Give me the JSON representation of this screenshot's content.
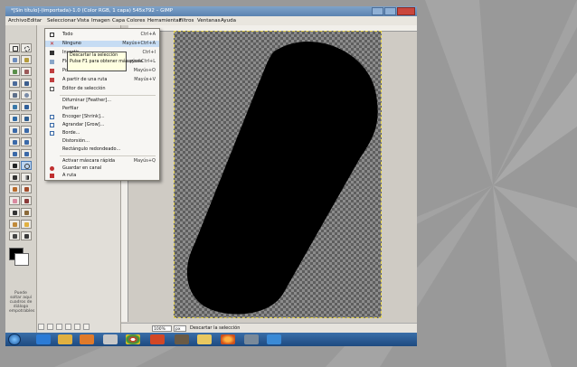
{
  "window": {
    "title": "*[Sin título]-(importada)-1.0 (Color RGB, 1 capa) 545x792 – GIMP"
  },
  "menubar": [
    "Archivo",
    "Editar",
    "Seleccionar",
    "Vista",
    "Imagen",
    "Capa",
    "Colores",
    "Herramientas",
    "Filtros",
    "Ventanas",
    "Ayuda"
  ],
  "select_menu": {
    "items": [
      {
        "label": "Todo",
        "shortcut": "Ctrl+A"
      },
      {
        "label": "Ninguno",
        "shortcut": "Mayús+Ctrl+A"
      },
      {
        "label": "Invertir",
        "shortcut": "Ctrl+I"
      },
      {
        "label": "Flotante",
        "shortcut": "Mayús+Ctrl+L"
      },
      {
        "label": "Por color",
        "shortcut": "Mayús+O"
      },
      {
        "label": "A partir de una ruta",
        "shortcut": "Mayús+V"
      },
      {
        "label": "Editor de selección",
        "shortcut": ""
      },
      {
        "label": "Difuminar [Feather]...",
        "shortcut": ""
      },
      {
        "label": "Perfilar",
        "shortcut": ""
      },
      {
        "label": "Encoger [Shrink]...",
        "shortcut": ""
      },
      {
        "label": "Agrandar [Grow]...",
        "shortcut": ""
      },
      {
        "label": "Borde...",
        "shortcut": ""
      },
      {
        "label": "Distorsión...",
        "shortcut": ""
      },
      {
        "label": "Rectángulo redondeado...",
        "shortcut": ""
      },
      {
        "label": "Activar máscara rápida",
        "shortcut": "Mayús+Q"
      },
      {
        "label": "Guardar en canal",
        "shortcut": ""
      },
      {
        "label": "A ruta",
        "shortcut": ""
      }
    ],
    "tooltip_line1": "Descartar la selección",
    "tooltip_line2": "Pulse F1 para obtener más ayuda"
  },
  "toolbox": {
    "foreground_color": "#000000",
    "background_color": "#ffffff",
    "hint_text": "Puede soltar aquí cuadros de diálogo empotrables"
  },
  "statusbar": {
    "zoom": "100%",
    "unit": "px",
    "message": "Descartar la selección"
  },
  "colors": {
    "accent_highlight": "#c6dcf3",
    "selection_border": "#e7d44a",
    "shape_fill": "#000000"
  },
  "taskbar": {
    "icons": [
      "ie-icon",
      "explorer-icon",
      "media-player-icon",
      "chrome-icon",
      "powerpoint-icon",
      "gimp-icon",
      "folder-icon",
      "firefox-icon",
      "gimp-window-icon",
      "app-icon"
    ]
  }
}
